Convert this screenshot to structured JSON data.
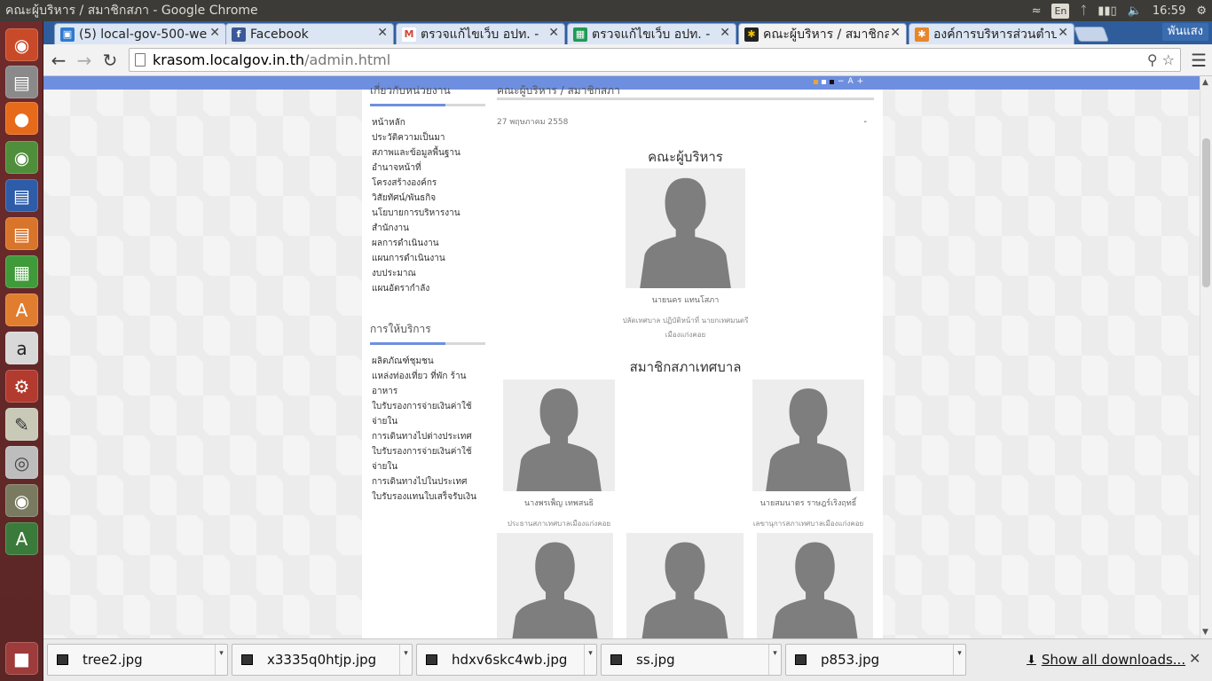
{
  "window": {
    "title": "คณะผู้บริหาร / สมาชิกสภา - Google Chrome"
  },
  "tray": {
    "lang": "En",
    "time": "16:59"
  },
  "colors": {
    "accent": "#6e8fe0",
    "launcher": "#6e2b2b",
    "tabstrip": "#2f5d9c"
  },
  "tabs": [
    {
      "label": "(5) local-gov-500-we",
      "icon": "trello-icon",
      "active": false
    },
    {
      "label": "Facebook",
      "icon": "facebook-icon",
      "active": false
    },
    {
      "label": "ตรวจแก้ไขเว็บ อปท. -",
      "icon": "gmail-icon",
      "active": false
    },
    {
      "label": "ตรวจแก้ไขเว็บ อปท. -",
      "icon": "sheets-icon",
      "active": false
    },
    {
      "label": "คณะผู้บริหาร / สมาชิกส",
      "icon": "joomla-icon",
      "active": true
    },
    {
      "label": "องค์การบริหารส่วนตำบ",
      "icon": "joomla-icon",
      "active": false
    }
  ],
  "user": "พันแสง",
  "omnibox": {
    "host": "krasom.localgov.in.th",
    "path": "/admin.html"
  },
  "sidebar": {
    "about_title": "เกี่ยวกับหน่วยงาน",
    "about_items": [
      "หน้าหลัก",
      "ประวัติความเป็นมา",
      "สภาพและข้อมูลพื้นฐาน",
      "อำนาจหน้าที่",
      "โครงสร้างองค์กร",
      "วิสัยทัศน์/พันธกิจ",
      "นโยบายการบริหารงาน",
      "สำนักงาน",
      "ผลการดำเนินงาน",
      "แผนการดำเนินงาน",
      "งบประมาณ",
      "แผนอัตรากำลัง"
    ],
    "services_title": "การให้บริการ",
    "services_items": [
      "ผลิตภัณฑ์ชุมชน",
      "แหล่งท่องเที่ยว ที่พัก ร้านอาหาร",
      "ใบรับรองการจ่ายเงินค่าใช้จ่ายใน",
      "การเดินทางไปต่างประเทศ",
      "ใบรับรองการจ่ายเงินค่าใช้จ่ายใน",
      "การเดินทางไปในประเทศ",
      "ใบรับรองแทนใบเสร็จรับเงิน"
    ]
  },
  "main": {
    "breadcrumb": "คณะผู้บริหาร / สมาชิกสภา",
    "date": "27 พฤษภาคม 2558",
    "collapse": "-",
    "exec_title": "คณะผู้บริหาร",
    "exec": {
      "name": "นายนคร แทนโสภา",
      "role_line1": "ปลัดเทศบาล ปฏิบัติหน้าที่ นายกเทศมนตรี",
      "role_line2": "เมืองแก่งคอย"
    },
    "council_title": "สมาชิกสภาเทศบาล",
    "council": [
      {
        "name": "นางพรเพ็ญ เทพสนธิ",
        "role": "ประธานสภาเทศบาลเมืองแก่งคอย"
      },
      {
        "name": "นายสมนาตร ราษฎร์เริงฤทธิ์",
        "role": "เลขานุการสภาเทศบาลเมืองแก่งคอย"
      }
    ]
  },
  "downloads": [
    {
      "filename": "tree2.jpg"
    },
    {
      "filename": "x3335q0htjp.jpg"
    },
    {
      "filename": "hdxv6skc4wb.jpg"
    },
    {
      "filename": "ss.jpg"
    },
    {
      "filename": "p853.jpg"
    }
  ],
  "show_all": "Show all downloads..."
}
